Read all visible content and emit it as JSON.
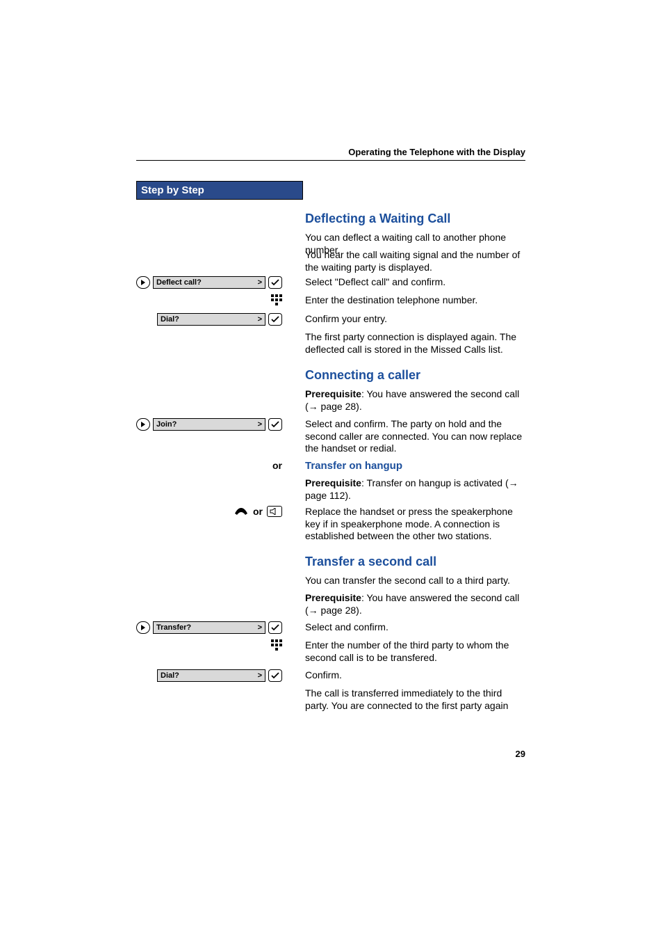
{
  "header": {
    "section_title": "Operating the Telephone with the Display"
  },
  "sidebar": {
    "title": "Step by Step",
    "steps": {
      "deflect_call": "Deflect call?",
      "dial1": "Dial?",
      "join": "Join?",
      "or1": "or",
      "or2": "or",
      "transfer": "Transfer?",
      "dial2": "Dial?"
    }
  },
  "content": {
    "deflecting": {
      "title": "Deflecting a Waiting Call",
      "p1": "You can deflect a waiting call to another phone number.",
      "p2": "You hear the call waiting signal and the number of the waiting party is displayed.",
      "p3": "Select \"Deflect call\" and confirm.",
      "p4": "Enter the destination telephone number.",
      "p5": "Confirm your entry.",
      "p6": "The first party connection is displayed again. The deflected call is stored in the Missed Calls list."
    },
    "connecting": {
      "title": "Connecting a caller",
      "prereq_label": "Prerequisite",
      "prereq_text": ": You have answered the second call (",
      "prereq_ref_arrow": "→",
      "prereq_ref": " page 28).",
      "p1": "Select and confirm. The party on hold and the second caller are connected. You can now replace the handset or redial.",
      "transfer_hangup_title": "Transfer on hangup",
      "prereq2_label": "Prerequisite",
      "prereq2_text": ": Transfer on hangup is activated (",
      "prereq2_ref_arrow": "→",
      "prereq2_ref": " page 112).",
      "p2": "Replace the handset or press the speakerphone key if in speakerphone mode. A connection is established between the other two stations."
    },
    "transfer2": {
      "title": "Transfer a second call",
      "p1": "You can transfer the second call to a third party.",
      "prereq_label": "Prerequisite",
      "prereq_text": ": You have answered the second call (",
      "prereq_ref_arrow": "→",
      "prereq_ref": " page 28).",
      "p2": "Select and confirm.",
      "p3": "Enter the number of the third party to whom the second call is to be transfered.",
      "p4": "Confirm.",
      "p5": "The call is transferred immediately to the third party. You are connected to the first party again"
    }
  },
  "page_number": "29"
}
